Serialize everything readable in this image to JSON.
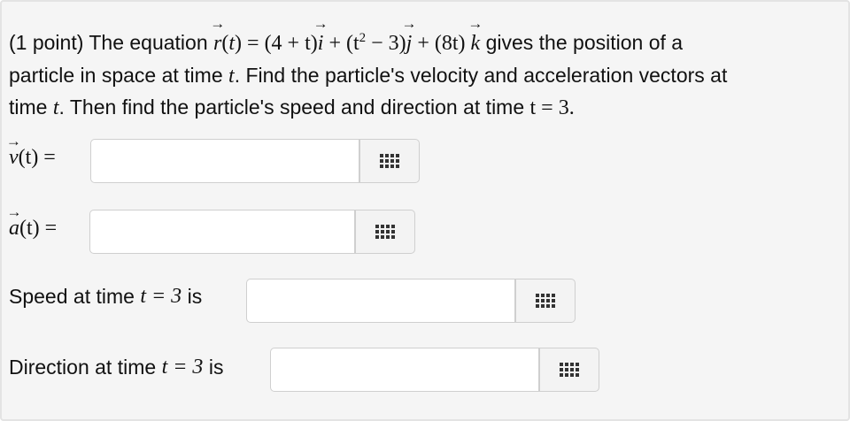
{
  "problem": {
    "prefix": "(1 point) The equation",
    "r_func": "r",
    "t_var": "t",
    "eq_i": "= (4 + t)",
    "i_hat": "i",
    "eq_j_a": "+ (t",
    "sq": "2",
    "eq_j_b": "− 3)",
    "j_hat": "j",
    "eq_k": "+ (8t)",
    "k_hat": "k",
    "line1_end": "gives the position of a",
    "line2": "particle in space at time",
    "line2_end": ". Find the particle's velocity and acceleration vectors at",
    "line3_start": "time",
    "line3_mid": ". Then find the particle's speed and direction at time",
    "t_eq": "t = 3."
  },
  "fields": {
    "velocity": {
      "vec": "v",
      "arg": "(t) ="
    },
    "acceleration": {
      "vec": "a",
      "arg": "(t) ="
    },
    "speed": {
      "text": "Speed at time",
      "math": "t = 3",
      "suffix": "is"
    },
    "direction": {
      "text": "Direction at time",
      "math": "t = 3",
      "suffix": "is"
    }
  },
  "icons": {
    "answer_button": "keypad-grid-icon"
  }
}
